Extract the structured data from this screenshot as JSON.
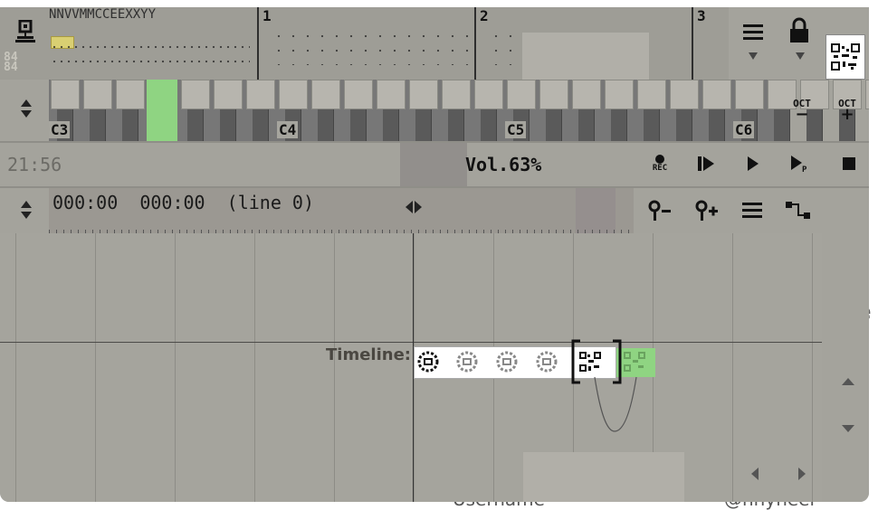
{
  "pattern": {
    "track_header": "NNVVMMCCEEXXYY",
    "columns": [
      "1",
      "2",
      "3"
    ],
    "side_label": "84\n84"
  },
  "piano": {
    "octaves": [
      "C3",
      "C4",
      "C5",
      "C6"
    ],
    "highlight_key": "C3 F"
  },
  "right_panel": {
    "menu_icon": "hamburger-menu-icon",
    "lock_icon": "lock-icon",
    "qr_icon": "qr-code-icon",
    "oct_minus_label": "OCT",
    "oct_plus_label": "OCT"
  },
  "status": {
    "time": "21:56",
    "volume": "Vol.63%",
    "rec_label": "REC"
  },
  "timeline_header": {
    "position": "000:00  000:00  (line 0)"
  },
  "timeline": {
    "label": "Timeline:",
    "modules": [
      "module-1",
      "module-2",
      "module-3",
      "module-4",
      "module-5",
      "module-6"
    ]
  },
  "background_text": {
    "right_letter": "e",
    "username": "Username",
    "handle": "@nnyneer"
  },
  "colors": {
    "panel": "#a4a39c",
    "highlight_green": "#8fd482",
    "yellow_note": "#d9cf72"
  }
}
